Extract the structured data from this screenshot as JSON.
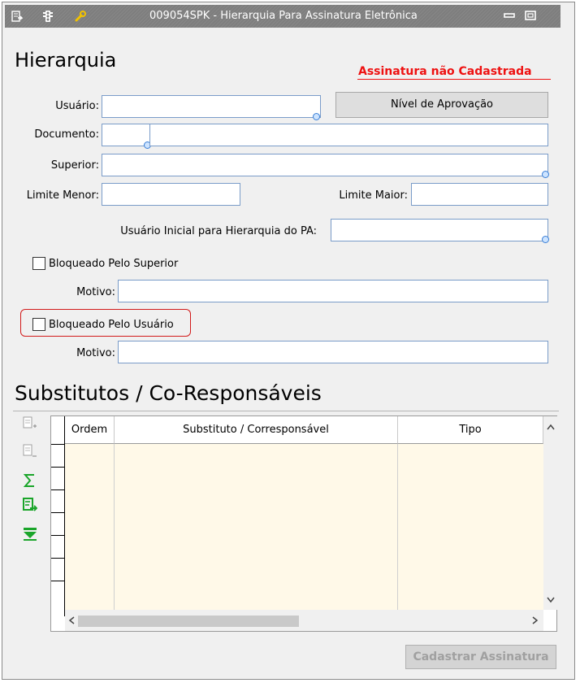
{
  "window": {
    "title": "009054SPK - Hierarquia Para Assinatura Eletrônica",
    "icons": [
      "document-arrow-icon",
      "traffic-light-icon",
      "wrench-icon"
    ],
    "controls": [
      "minimize-icon",
      "restore-icon"
    ]
  },
  "header": {
    "title": "Hierarquia",
    "status": "Assinatura  não Cadastrada",
    "status_color": "#ee1111"
  },
  "form": {
    "usuario_label": "Usuário:",
    "usuario_value": "",
    "nivel_button": "Nível de Aprovação",
    "documento_label": "Documento:",
    "documento_code": "",
    "documento_desc": "",
    "superior_label": "Superior:",
    "superior_value": "",
    "limite_menor_label": "Limite Menor:",
    "limite_menor_value": "",
    "limite_maior_label": "Limite Maior:",
    "limite_maior_value": "",
    "usuario_inicial_label": "Usuário Inicial para Hierarquia do PA:",
    "usuario_inicial_value": "",
    "bloq_superior_label": "Bloqueado Pelo Superior",
    "bloq_superior_checked": false,
    "motivo1_label": "Motivo:",
    "motivo1_value": "",
    "bloq_usuario_label": "Bloqueado Pelo Usuário",
    "bloq_usuario_checked": false,
    "motivo2_label": "Motivo:",
    "motivo2_value": ""
  },
  "substitutos": {
    "title": "Substitutos / Co-Responsáveis",
    "columns": [
      "Ordem",
      "Substituto / Corresponsável",
      "Tipo"
    ],
    "rows": [],
    "side_toolbar": [
      "add-row-icon",
      "remove-row-icon",
      "sum-icon",
      "export-icon",
      "filter-icon"
    ]
  },
  "footer": {
    "cadastrar_button": "Cadastrar Assinatura",
    "cadastrar_enabled": false
  }
}
